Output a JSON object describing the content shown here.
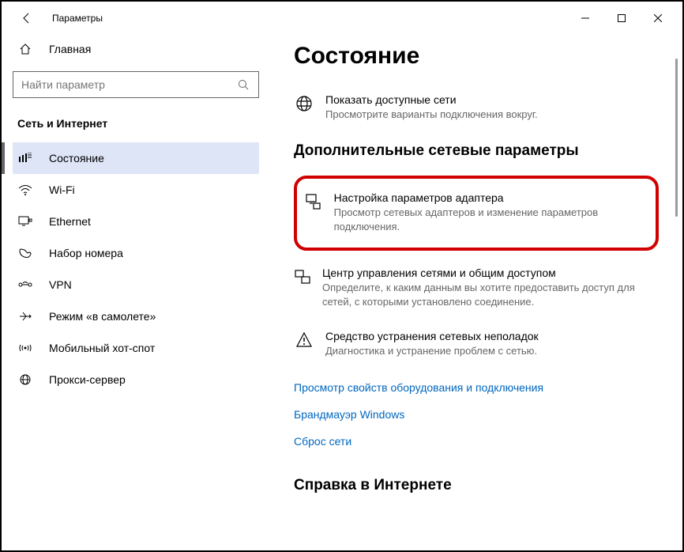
{
  "window": {
    "title": "Параметры"
  },
  "sidebar": {
    "home_label": "Главная",
    "search_placeholder": "Найти параметр",
    "category": "Сеть и Интернет",
    "items": [
      {
        "label": "Состояние"
      },
      {
        "label": "Wi-Fi"
      },
      {
        "label": "Ethernet"
      },
      {
        "label": "Набор номера"
      },
      {
        "label": "VPN"
      },
      {
        "label": "Режим «в самолете»"
      },
      {
        "label": "Мобильный хот-спот"
      },
      {
        "label": "Прокси-сервер"
      }
    ]
  },
  "main": {
    "page_title": "Состояние",
    "available_networks": {
      "title": "Показать доступные сети",
      "desc": "Просмотрите варианты подключения вокруг."
    },
    "advanced_section": "Дополнительные сетевые параметры",
    "adapter": {
      "title": "Настройка параметров адаптера",
      "desc": "Просмотр сетевых адаптеров и изменение параметров подключения."
    },
    "sharing": {
      "title": "Центр управления сетями и общим доступом",
      "desc": "Определите, к каким данным вы хотите предоставить доступ для сетей, с которыми установлено соединение."
    },
    "troubleshoot": {
      "title": "Средство устранения сетевых неполадок",
      "desc": "Диагностика и устранение проблем с сетью."
    },
    "links": {
      "hardware": "Просмотр свойств оборудования и подключения",
      "firewall": "Брандмауэр Windows",
      "reset": "Сброс сети"
    },
    "help_section": "Справка в Интернете"
  }
}
